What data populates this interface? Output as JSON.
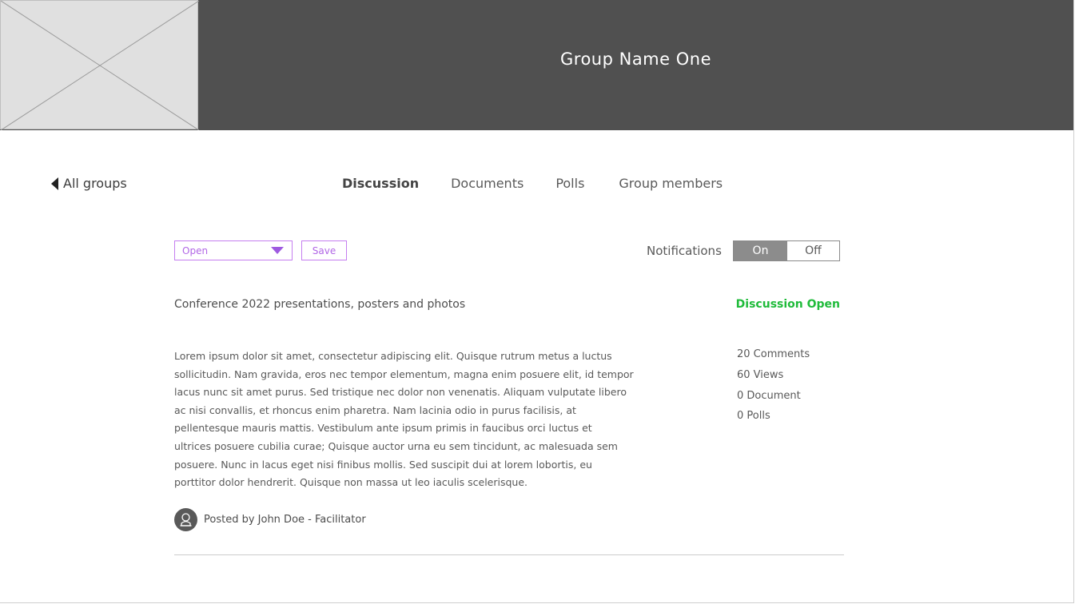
{
  "header": {
    "group_name": "Group Name One"
  },
  "nav": {
    "back_label": "All groups",
    "tabs": [
      {
        "label": "Discussion",
        "active": true
      },
      {
        "label": "Documents",
        "active": false
      },
      {
        "label": "Polls",
        "active": false
      },
      {
        "label": "Group members",
        "active": false
      }
    ]
  },
  "controls": {
    "status_select_value": "Open",
    "save_label": "Save",
    "notifications_label": "Notifications",
    "toggle_on_label": "On",
    "toggle_off_label": "Off",
    "notifications_state": "On"
  },
  "discussion": {
    "title": "Conference 2022 presentations, posters and photos",
    "status": "Discussion Open",
    "status_color": "#1fbb3a",
    "body_lines": [
      "Lorem ipsum dolor sit amet, consectetur adipiscing elit. Quisque rutrum metus a luctus",
      "sollicitudin. Nam gravida, eros nec tempor elementum, magna enim posuere elit, id tempor",
      "lacus nunc sit amet purus. Sed tristique nec dolor non venenatis. Aliquam vulputate libero",
      "ac nisi convallis, et rhoncus enim pharetra. Nam lacinia odio in purus facilisis, at",
      "pellentesque mauris mattis. Vestibulum ante ipsum primis in faucibus orci luctus et",
      "ultrices posuere cubilia curae; Quisque auctor urna eu sem tincidunt, ac malesuada sem",
      "posuere. Nunc in lacus eget nisi finibus mollis. Sed suscipit dui at lorem lobortis, eu",
      "porttitor dolor hendrerit. Quisque non massa ut leo iaculis scelerisque."
    ],
    "stats": {
      "comments": "20 Comments",
      "views": "60 Views",
      "documents": "0 Document",
      "polls": "0 Polls"
    },
    "posted_by": "Posted by John Doe - Facilitator"
  },
  "colors": {
    "accent": "#c57ef0",
    "header_bg": "#505050",
    "toggle_active": "#8c8c8c"
  },
  "icons": [
    "image-placeholder-icon",
    "back-arrow-icon",
    "dropdown-caret-icon",
    "user-avatar-icon"
  ]
}
